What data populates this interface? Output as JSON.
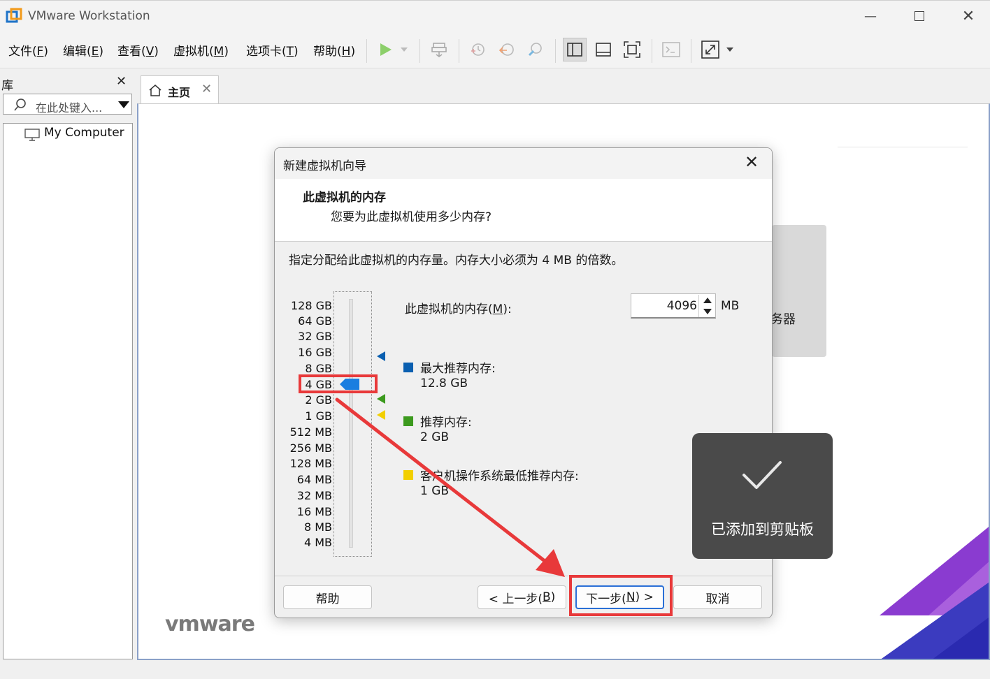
{
  "app": {
    "title": "VMware Workstation"
  },
  "menu": {
    "items": [
      {
        "text": "文件(",
        "key": "F",
        "tail": ")"
      },
      {
        "text": "编辑(",
        "key": "E",
        "tail": ")"
      },
      {
        "text": "查看(",
        "key": "V",
        "tail": ")"
      },
      {
        "text": "虚拟机(",
        "key": "M",
        "tail": ")"
      },
      {
        "text": "选项卡(",
        "key": "T",
        "tail": ")"
      },
      {
        "text": "帮助(",
        "key": "H",
        "tail": ")"
      }
    ]
  },
  "library": {
    "title": "库",
    "search_placeholder": "在此处键入...",
    "tree_item": "My Computer"
  },
  "tabs": [
    {
      "label": "主页"
    }
  ],
  "home": {
    "card_text": "务器",
    "logo": "vmware"
  },
  "dialog": {
    "title": "新建虚拟机向导",
    "heading": "此虚拟机的内存",
    "subheading": "您要为此虚拟机使用多少内存?",
    "description": "指定分配给此虚拟机的内存量。内存大小必须为 4 MB 的倍数。",
    "scale_labels": [
      "128 GB",
      "64 GB",
      "32 GB",
      "16 GB",
      "8 GB",
      "4 GB",
      "2 GB",
      "1 GB",
      "512 MB",
      "256 MB",
      "128 MB",
      "64 MB",
      "32 MB",
      "16 MB",
      "8 MB",
      "4 MB"
    ],
    "memory_label_pre": "此虚拟机的内存(",
    "memory_label_key": "M",
    "memory_label_post": "):",
    "memory_value": "4096",
    "memory_unit": "MB",
    "slider_selected": "4 GB",
    "legend": {
      "max_title": "最大推荐内存:",
      "max_value": "12.8 GB",
      "max_color": "#0a5fb0",
      "rec_title": "推荐内存:",
      "rec_value": "2 GB",
      "rec_color": "#3c9a1e",
      "min_title": "客户机操作系统最低推荐内存:",
      "min_value": "1 GB",
      "min_color": "#f2cf00"
    },
    "buttons": {
      "help": "帮助",
      "back_pre": "< 上一步(",
      "back_key": "B",
      "back_post": ")",
      "next_pre": "下一步(",
      "next_key": "N",
      "next_post": ") >",
      "cancel": "取消"
    }
  },
  "toast": {
    "text": "已添加到剪贴板"
  },
  "colors": {
    "highlight": "#e8393a",
    "accent": "#2a6fd6",
    "thumb": "#1a7ee0"
  }
}
